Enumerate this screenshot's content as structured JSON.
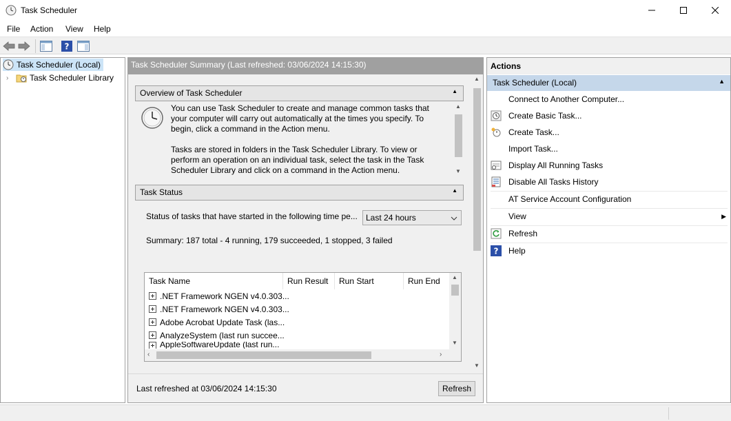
{
  "window": {
    "title": "Task Scheduler",
    "minimize_icon": "minimize-icon",
    "maximize_icon": "maximize-icon",
    "close_icon": "close-icon"
  },
  "menubar": {
    "items": [
      "File",
      "Action",
      "View",
      "Help"
    ]
  },
  "toolbar": {
    "icons": [
      "back-arrow-icon",
      "forward-arrow-icon",
      "show-hide-console-tree-icon",
      "help-icon",
      "show-hide-action-pane-icon"
    ]
  },
  "tree": {
    "root": "Task Scheduler (Local)",
    "child": "Task Scheduler Library"
  },
  "center": {
    "header": "Task Scheduler Summary (Last refreshed: 03/06/2024 14:15:30)",
    "overview": {
      "title": "Overview of Task Scheduler",
      "para1_lines": [
        "You can use Task Scheduler to create and manage common tasks that",
        "your computer will carry out automatically at the times you specify. To",
        "begin, click a command in the Action menu."
      ],
      "para2_lines": [
        "Tasks are stored in folders in the Task Scheduler Library. To view or",
        "perform an operation on an individual task, select the task in the Task",
        "Scheduler Library and click on a command in the Action menu."
      ]
    },
    "task_status": {
      "title": "Task Status",
      "filter_label": "Status of tasks that have started in the following time pe...",
      "filter_value": "Last 24 hours",
      "summary": "Summary: 187 total - 4 running, 179 succeeded, 1 stopped, 3 failed",
      "columns": [
        "Task Name",
        "Run Result",
        "Run Start",
        "Run End"
      ],
      "rows": [
        ".NET Framework NGEN v4.0.303...",
        ".NET Framework NGEN v4.0.303...",
        "Adobe Acrobat Update Task (las...",
        "AnalyzeSystem (last run succee...",
        "AppleSoftwareUpdate (last run..."
      ]
    },
    "footer": {
      "last_refreshed": "Last refreshed at 03/06/2024 14:15:30",
      "refresh_button": "Refresh"
    }
  },
  "actions": {
    "title": "Actions",
    "group": "Task Scheduler (Local)",
    "items": [
      {
        "label": "Connect to Another Computer...",
        "icon": ""
      },
      {
        "label": "Create Basic Task...",
        "icon": "create-basic-task-icon"
      },
      {
        "label": "Create Task...",
        "icon": "create-task-icon"
      },
      {
        "label": "Import Task...",
        "icon": ""
      },
      {
        "label": "Display All Running Tasks",
        "icon": "running-tasks-icon"
      },
      {
        "label": "Disable All Tasks History",
        "icon": "tasks-history-icon"
      },
      {
        "label": "AT Service Account Configuration",
        "icon": ""
      },
      {
        "label": "View",
        "icon": ""
      },
      {
        "label": "Refresh",
        "icon": "refresh-icon"
      },
      {
        "label": "Help",
        "icon": "help-icon"
      }
    ]
  }
}
